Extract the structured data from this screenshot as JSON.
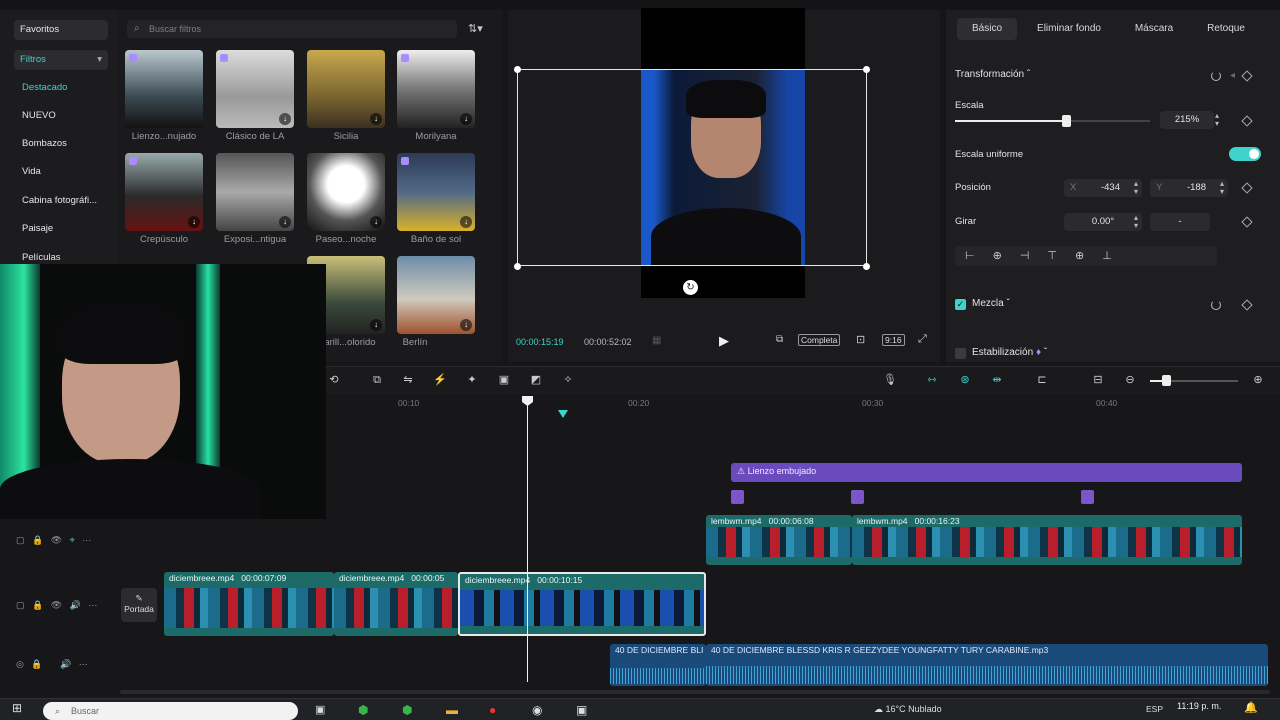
{
  "sidebar": {
    "items": [
      "Favoritos",
      "Filtros",
      "Destacado",
      "NUEVO",
      "Bombazos",
      "Vida",
      "Cabina fotográfi...",
      "Paisaje",
      "Películas"
    ]
  },
  "filters": {
    "search_placeholder": "Buscar filtros",
    "items": [
      {
        "label": "Lienzo...nujado"
      },
      {
        "label": "Clásico de LA"
      },
      {
        "label": "Sicilia"
      },
      {
        "label": "Morilyana"
      },
      {
        "label": "Crepúsculo"
      },
      {
        "label": "Exposi...ntigua"
      },
      {
        "label": "Paseo...noche"
      },
      {
        "label": "Baño de sol"
      },
      {
        "label": "...arill...olorido"
      },
      {
        "label": "Berlín"
      }
    ]
  },
  "player": {
    "current_time": "00:00:15:19",
    "total_time": "00:00:52:02",
    "ratio_label": "Completa",
    "aspect_label": "9:16"
  },
  "props": {
    "tabs": [
      "Básico",
      "Eliminar fondo",
      "Máscara",
      "Retoque"
    ],
    "transform_label": "Transformación",
    "scale_label": "Escala",
    "scale_value": "215%",
    "scale_fraction": 0.57,
    "uniform_label": "Escala uniforme",
    "position_label": "Posición",
    "x_prefix": "X",
    "x_value": "-434",
    "y_prefix": "Y",
    "y_value": "-188",
    "rotate_label": "Girar",
    "rotate_value": "0.00°",
    "rotate_minus": "-",
    "blend_label": "Mezcla",
    "stabil_label": "Estabilización"
  },
  "timeline": {
    "ruler": [
      "00:10",
      "00:20",
      "00:30",
      "00:40"
    ],
    "effect_label": "Lienzo embujado",
    "cover_label": "Portada",
    "overlay_clips": [
      {
        "name": "lembwm.mp4",
        "dur": "00:00:06:08"
      },
      {
        "name": "lembwm.mp4",
        "dur": "00:00:16:23"
      }
    ],
    "main_clips": [
      {
        "name": "diciembreee.mp4",
        "dur": "00:00:07:09"
      },
      {
        "name": "diciembreee.mp4",
        "dur": "00:00:05"
      },
      {
        "name": "diciembreee.mp4",
        "dur": "00:00:10:15"
      }
    ],
    "audio": [
      {
        "name": "40 DE DICIEMBRE  BLI"
      },
      {
        "name": "40 DE DICIEMBRE  BLESSD  KRIS R  GEEZYDEE  YOUNGFATTY  TURY  CARABINE.mp3"
      }
    ]
  },
  "taskbar": {
    "search": "Buscar",
    "weather": "16°C  Nublado",
    "time": "11:19 p. m.",
    "lang": "ESP"
  },
  "colors": {
    "accent": "#3fd3cb",
    "purple": "#7b55c9",
    "clip": "#1d6b68"
  }
}
